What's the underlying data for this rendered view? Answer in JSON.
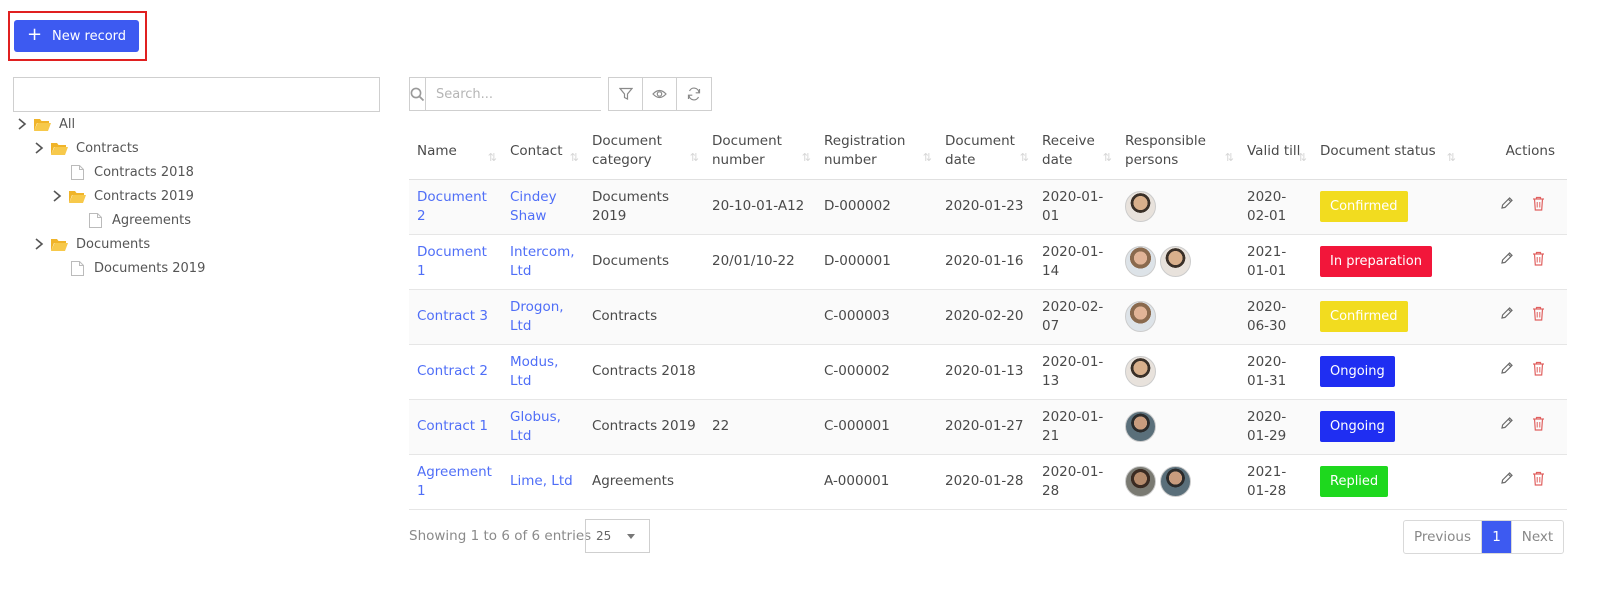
{
  "new_record_label": "New record",
  "tree": {
    "search_placeholder": "",
    "nodes": [
      {
        "label": "All"
      },
      {
        "label": "Contracts"
      },
      {
        "label": "Contracts 2018"
      },
      {
        "label": "Contracts 2019"
      },
      {
        "label": "Agreements"
      },
      {
        "label": "Documents"
      },
      {
        "label": "Documents 2019"
      }
    ]
  },
  "toolbar": {
    "search_placeholder": "Search..."
  },
  "table": {
    "headers": {
      "name": "Name",
      "contact": "Contact",
      "category": "Document category",
      "doc_number": "Document number",
      "reg_number": "Registration number",
      "doc_date": "Document date",
      "receive_date": "Receive date",
      "persons": "Responsible persons",
      "valid_till": "Valid till",
      "status": "Document status",
      "actions": "Actions"
    },
    "rows": [
      {
        "name": "Document 2",
        "contact": "Cindey Shaw",
        "category": "Documents 2019",
        "doc_number": "20-10-01-A12",
        "reg_number": "D-000002",
        "doc_date": "2020-01-23",
        "receive_date": "2020-01-01",
        "valid_till": "2020-02-01",
        "status": "Confirmed"
      },
      {
        "name": "Document 1",
        "contact": "Intercom, Ltd",
        "category": "Documents",
        "doc_number": "20/01/10-22",
        "reg_number": "D-000001",
        "doc_date": "2020-01-16",
        "receive_date": "2020-01-14",
        "valid_till": "2021-01-01",
        "status": "In preparation"
      },
      {
        "name": "Contract 3",
        "contact": "Drogon, Ltd",
        "category": "Contracts",
        "doc_number": "",
        "reg_number": "C-000003",
        "doc_date": "2020-02-20",
        "receive_date": "2020-02-07",
        "valid_till": "2020-06-30",
        "status": "Confirmed"
      },
      {
        "name": "Contract 2",
        "contact": "Modus, Ltd",
        "category": "Contracts 2018",
        "doc_number": "",
        "reg_number": "C-000002",
        "doc_date": "2020-01-13",
        "receive_date": "2020-01-13",
        "valid_till": "2020-01-31",
        "status": "Ongoing"
      },
      {
        "name": "Contract 1",
        "contact": "Globus, Ltd",
        "category": "Contracts 2019",
        "doc_number": "22",
        "reg_number": "C-000001",
        "doc_date": "2020-01-27",
        "receive_date": "2020-01-21",
        "valid_till": "2020-01-29",
        "status": "Ongoing"
      },
      {
        "name": "Agreement 1",
        "contact": "Lime, Ltd",
        "category": "Agreements",
        "doc_number": "",
        "reg_number": "A-000001",
        "doc_date": "2020-01-28",
        "receive_date": "2020-01-28",
        "valid_till": "2021-01-28",
        "status": "Replied"
      }
    ]
  },
  "status_colors": {
    "Confirmed": "#f2dc1f",
    "In preparation": "#f2163a",
    "Ongoing": "#1f2ef2",
    "Replied": "#1ed81e"
  },
  "footer": {
    "info": "Showing 1 to 6 of 6 entries",
    "page_size": "25",
    "prev": "Previous",
    "current": "1",
    "next": "Next"
  }
}
